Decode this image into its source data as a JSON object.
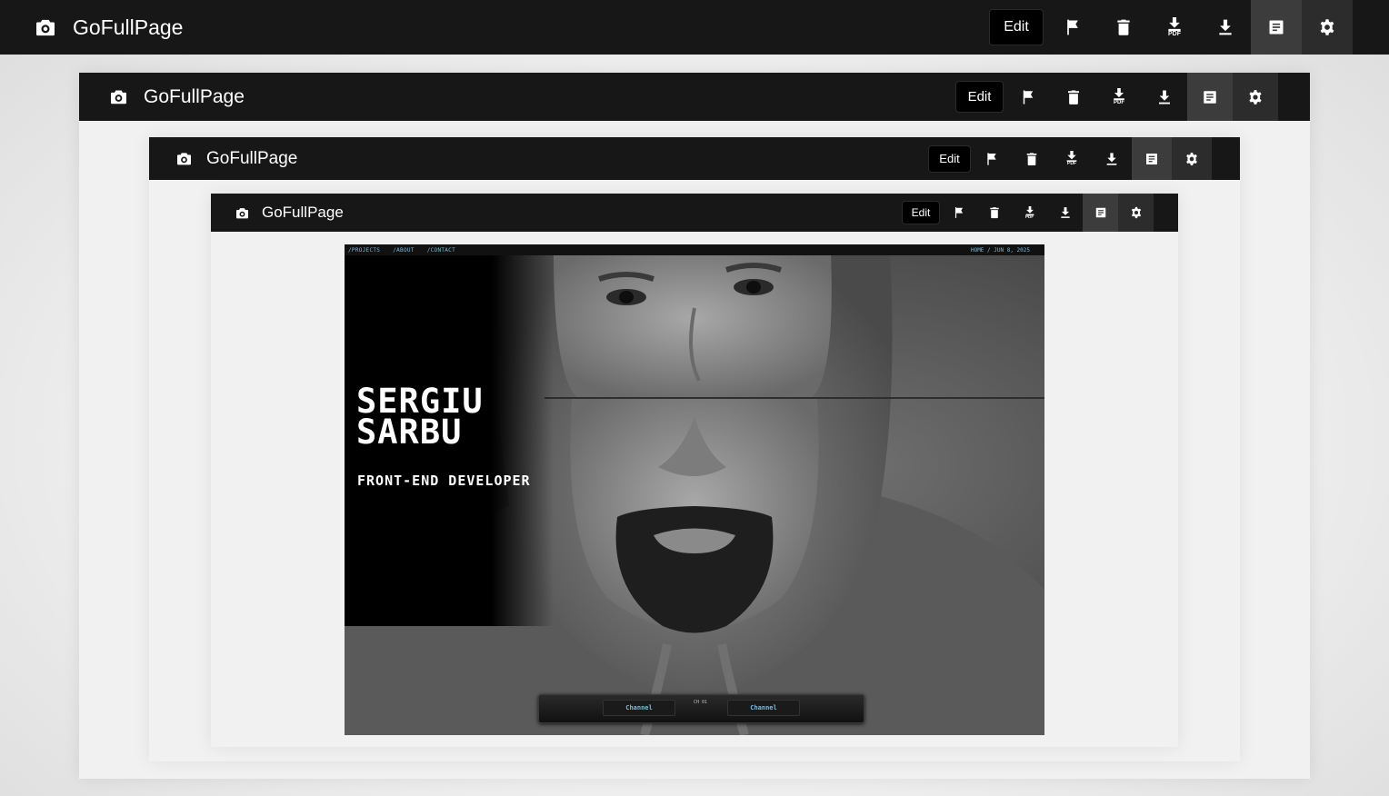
{
  "extension": {
    "title": "GoFullPage",
    "edit_label": "Edit",
    "pdf_label": "PDF",
    "icons": [
      "camera-icon",
      "flag-icon",
      "trash-icon",
      "download-pdf-icon",
      "download-icon",
      "notes-icon",
      "gear-icon"
    ]
  },
  "captured_page": {
    "nav": [
      "/PROJECTS",
      "/ABOUT",
      "/CONTACT"
    ],
    "breadcrumb": "HOME / JUN 8, 2025",
    "name": "SERGIU\nSARBU",
    "role": "FRONT-END DEVELOPER",
    "channel_left": "Channel",
    "channel_right": "Channel",
    "channel_indicator": "CH 01"
  },
  "colors": {
    "toolbar_bg": "#171717",
    "active_button_bg": "#3c3c3c",
    "page_bg": "#f1f1f1",
    "nav_text": "#7fb8d8"
  }
}
